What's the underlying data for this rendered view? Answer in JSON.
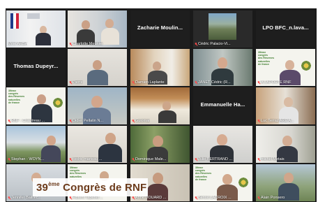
{
  "participants": [
    {
      "name": "Mme ARBA",
      "muted": false
    },
    {
      "name": "Charlotte Meunier",
      "muted": true
    },
    {
      "name": "Zacharie  Moulin...",
      "muted": false
    },
    {
      "name": "Cédric Palacio-Vi...",
      "muted": true
    },
    {
      "name": "LPO  BFC_n.lava...",
      "muted": false
    },
    {
      "name": "Thomas  Dupeyr...",
      "muted": false
    },
    {
      "name": "Pierre",
      "muted": true
    },
    {
      "name": "Damien Laplante",
      "muted": true
    },
    {
      "name": "JANET Cédric (R...",
      "muted": true
    },
    {
      "name": "A.LAPORTE RNF",
      "muted": true
    },
    {
      "name": "RNF - Chantreau ...",
      "muted": true
    },
    {
      "name": "Didier Pellatin N...",
      "muted": true
    },
    {
      "name": "Guiomar",
      "muted": true
    },
    {
      "name": "Emmanuelle Ha...",
      "muted": false
    },
    {
      "name": "Luc Terraz ARE A...",
      "muted": true
    },
    {
      "name": "Stephan - WOYN...",
      "muted": true
    },
    {
      "name": "cedric marteau ...",
      "muted": true
    },
    {
      "name": "Dominique Male...",
      "muted": true
    },
    {
      "name": "Julie BERTRAND ...",
      "muted": true
    },
    {
      "name": "michel Metais",
      "muted": true
    },
    {
      "name": "Jennifer Bailliec...",
      "muted": true
    },
    {
      "name": "Florent Taberlet ...",
      "muted": true
    },
    {
      "name": "Anne DOUARD ...",
      "muted": true
    },
    {
      "name": "Benoît LACROIX ...",
      "muted": true
    },
    {
      "name": "Alain Ponsero",
      "muted": true
    }
  ],
  "congress_slide": {
    "line1": "39ème",
    "line2": "congrès",
    "line3": "des Réserves",
    "line4": "naturelles",
    "line5": "de france"
  },
  "banner": {
    "number": "39",
    "suffix": "ème",
    "text": " Congrès de RNF"
  },
  "colors": {
    "background": "#1a1a1a",
    "speaking_outline": "#d8d430",
    "muted_mic": "#ff4a4a",
    "banner_text": "#6b3a1a"
  }
}
